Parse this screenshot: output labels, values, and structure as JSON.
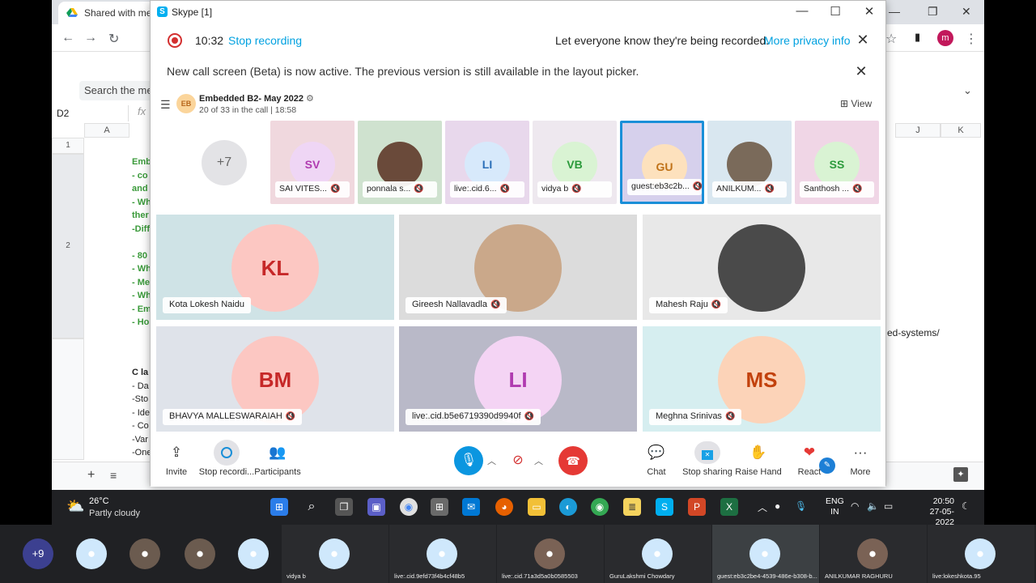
{
  "chrome": {
    "tab_title": "Shared with me -",
    "search_placeholder": "Search the me",
    "namebox": "D2",
    "fx": "fx",
    "profile_initial": "m",
    "columns": [
      "A",
      "J",
      "K"
    ],
    "rows": [
      "1",
      "2"
    ],
    "cell_green_lines": [
      "Emb",
      "- co",
      "and",
      "- Wh",
      "ther",
      "-Diff",
      "",
      "- 80",
      "- Wh",
      "- Me",
      "- Wh",
      "- Em",
      "- Ho"
    ],
    "cell_black_lines": [
      "C la",
      "- Da",
      "-Sto",
      "- Ide",
      "- Co",
      "-Var",
      "-One"
    ],
    "url_fragment": "ed-systems/"
  },
  "skype": {
    "window_title": "Skype [1]",
    "recording": {
      "time": "10:32",
      "stop_label": "Stop recording",
      "message": "Let everyone know they're being recorded.",
      "more_link": "More privacy info"
    },
    "beta_message": "New call screen (Beta) is now active. The previous version is still available in the layout picker.",
    "call": {
      "group_initials": "EB",
      "group_name": "Embedded B2- May 2022",
      "subtitle": "20 of 33 in the call | 18:58",
      "view_label": "View",
      "more_count": "+7"
    },
    "thumbnails": [
      {
        "initials": "SV",
        "name": "SAI VITES...",
        "color": "#b03ab0",
        "bg": "#f0d8de",
        "circle": "#efd6f5"
      },
      {
        "initials": "",
        "name": "ponnala s...",
        "color": "#333",
        "bg": "#cfe2cf",
        "circle": "#6a4a3a"
      },
      {
        "initials": "LI",
        "name": "live:.cid.6...",
        "color": "#2b6fb8",
        "bg": "#e8d8ec",
        "circle": "#d7e9fb"
      },
      {
        "initials": "VB",
        "name": "vidya b",
        "color": "#2b9a3b",
        "bg": "#eee8ef",
        "circle": "#d9f3d3"
      },
      {
        "initials": "GU",
        "name": "guest:eb3c2b...",
        "color": "#c07218",
        "bg": "#d6d0ec",
        "circle": "#fde1bd"
      },
      {
        "initials": "",
        "name": "ANILKUM...",
        "color": "#333",
        "bg": "#d9e7f0",
        "circle": "#7a6a5a"
      },
      {
        "initials": "SS",
        "name": "Santhosh ...",
        "color": "#2b9a3b",
        "bg": "#f0d6e6",
        "circle": "#d9f3d3"
      }
    ],
    "tiles": [
      {
        "initials": "KL",
        "name": "Kota Lokesh Naidu",
        "muted": false,
        "color": "#c62828",
        "bg": "#cfe3e6",
        "circle": "#fcc7c2"
      },
      {
        "initials": "",
        "name": "Gireesh Nallavadla",
        "muted": true,
        "color": "#333",
        "bg": "#dcdcdc",
        "circle": "#caa88a"
      },
      {
        "initials": "",
        "name": "Mahesh Raju",
        "muted": true,
        "color": "#333",
        "bg": "#e8e8e8",
        "circle": "#4a4a4a"
      },
      {
        "initials": "BM",
        "name": "BHAVYA MALLESWARAIAH",
        "muted": true,
        "color": "#c62828",
        "bg": "#dfe3ea",
        "circle": "#fcc7c2"
      },
      {
        "initials": "LI",
        "name": "live:.cid.b5e6719390d9940f",
        "muted": true,
        "color": "#b03ab0",
        "bg": "#b9b9c8",
        "circle": "#f4d4f4"
      },
      {
        "initials": "MS",
        "name": "Meghna Srinivas",
        "muted": true,
        "color": "#c2410c",
        "bg": "#d6eef0",
        "circle": "#fcd3b8"
      }
    ],
    "controls": {
      "invite": "Invite",
      "stop_recording": "Stop recordi...",
      "participants": "Participants",
      "chat": "Chat",
      "stop_sharing": "Stop sharing",
      "raise_hand": "Raise Hand",
      "react": "React",
      "more": "More"
    }
  },
  "taskbar": {
    "temperature": "26°C",
    "weather": "Partly cloudy",
    "lang_1": "ENG",
    "lang_2": "IN",
    "time": "20:50",
    "date": "27-05-2022"
  },
  "strip": {
    "more_count": "+9",
    "names": [
      "vidya b",
      "live:.cid.9efd73f4b4cf48b5",
      "live:.cid.71a3d5a0b0585503",
      "GuruLakshmi Chowdary",
      "guest:eb3c2be4-4539-486e-b308-b...",
      "ANILKUMAR RAGHURU",
      "live:lokeshkota.95"
    ]
  }
}
